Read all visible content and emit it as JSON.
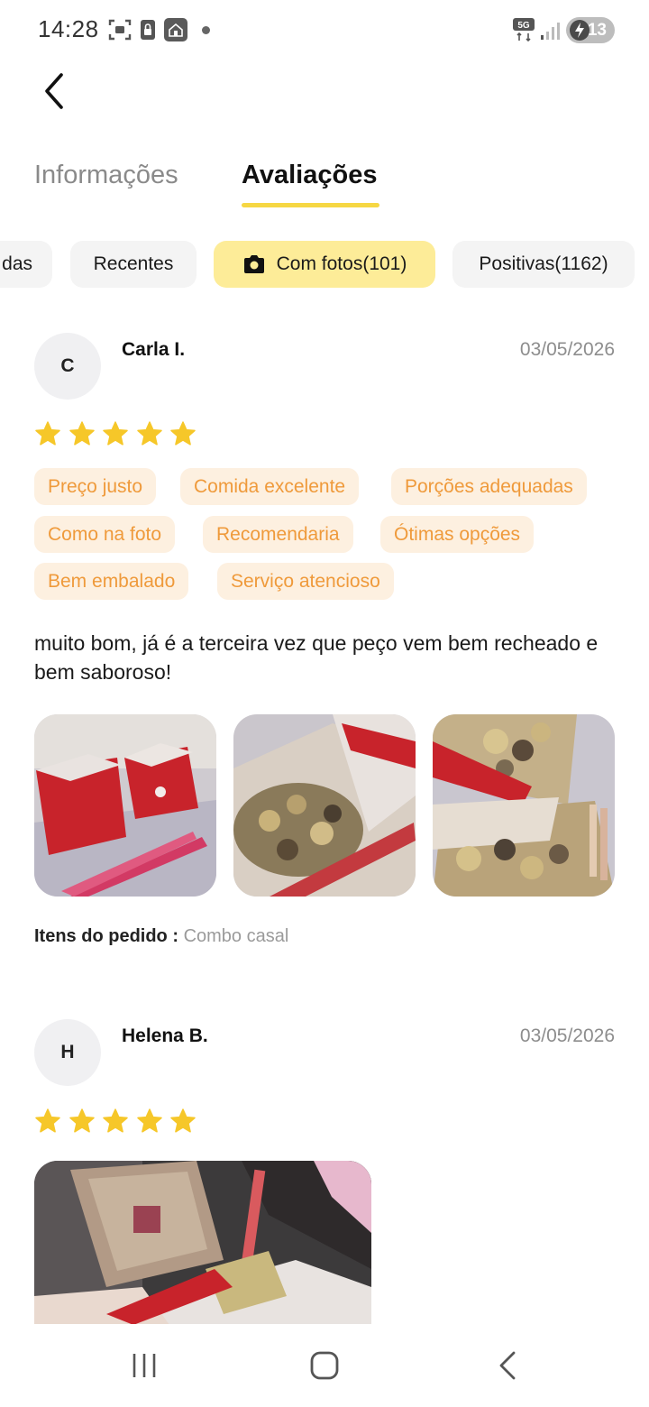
{
  "status_bar": {
    "time": "14:28",
    "network": "5G",
    "battery": "13"
  },
  "tabs": [
    {
      "label": "Informações",
      "active": false
    },
    {
      "label": "Avaliações",
      "active": true
    }
  ],
  "filters": [
    {
      "label": "das",
      "active": false
    },
    {
      "label": "Recentes",
      "active": false
    },
    {
      "label": "Com fotos(101)",
      "active": true,
      "icon": "camera-icon"
    },
    {
      "label": "Positivas(1162)",
      "active": false
    }
  ],
  "reviews": [
    {
      "initial": "C",
      "name": "Carla I.",
      "date": "03/05/2026",
      "stars": 5,
      "tags": [
        "Preço justo",
        "Comida excelente",
        "Porções adequadas",
        "Como na foto",
        "Recomendaria",
        "Ótimas opções",
        "Bem embalado",
        "Serviço atencioso"
      ],
      "text": "muito bom, já é a terceira vez que peço vem bem recheado e bem saboroso!",
      "photos": 3,
      "order_label": "Itens do pedido :",
      "order_value": "Combo casal"
    },
    {
      "initial": "H",
      "name": "Helena B.",
      "date": "03/05/2026",
      "stars": 5,
      "photos": 1
    }
  ],
  "colors": {
    "accent_yellow": "#f6d743",
    "chip_active": "#fdec98",
    "star": "#f6c729",
    "tag_bg": "#fdf0e0",
    "tag_text": "#ef9a3b"
  },
  "nav_bar": [
    "recent-apps-icon",
    "home-icon",
    "back-icon"
  ]
}
